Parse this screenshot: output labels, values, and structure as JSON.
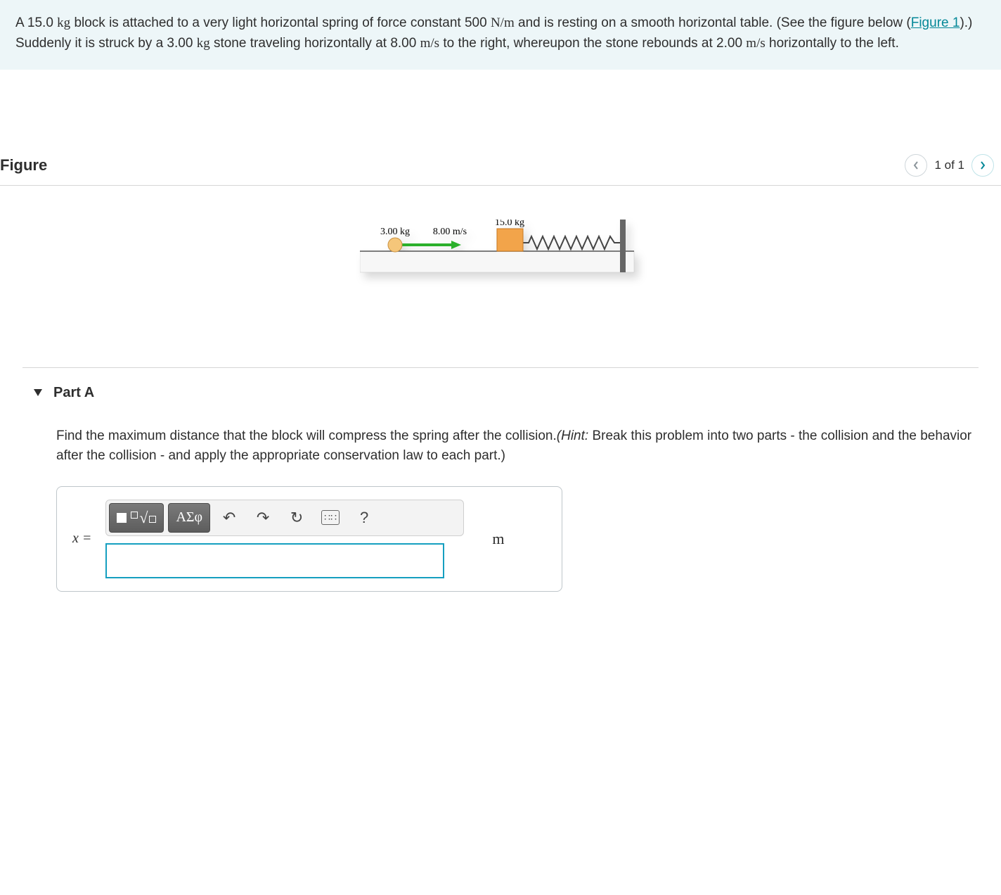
{
  "problem": {
    "text_parts": {
      "p1a": "A 15.0 ",
      "p1b": "kg",
      "p1c": " block is attached to a very light horizontal spring of force constant 500 ",
      "p1d": "N/m",
      "p1e": " and is resting on a smooth horizontal table. (See the figure below (",
      "fig_link": "Figure 1",
      "p1f": ").) Suddenly it is struck by a 3.00 ",
      "p1g": "kg",
      "p1h": " stone traveling horizontally at 8.00 ",
      "p1i": "m/s",
      "p1j": " to the right, whereupon the stone rebounds at 2.00 ",
      "p1k": "m/s",
      "p1l": " horizontally to the left."
    }
  },
  "figure": {
    "title": "Figure",
    "nav_label": "1 of 1",
    "labels": {
      "stone_mass": "3.00 kg",
      "stone_vel": "8.00 m/s",
      "block_mass": "15.0 kg"
    }
  },
  "part": {
    "header": "Part A",
    "question_parts": {
      "q1": "Find the maximum distance that the block will compress the spring after the collision.",
      "hint_label": "(Hint:",
      "q2": " Break this problem into two parts - the collision and the behavior after the collision - and apply the appropriate conservation law to each part.)"
    },
    "answer": {
      "var_label": "x =",
      "unit": "m",
      "value": "",
      "placeholder": ""
    },
    "toolbar": {
      "templates": "■",
      "formula": "√□",
      "greek": "ΑΣφ",
      "undo": "↶",
      "redo": "↷",
      "reset": "↻",
      "keyboard": "⌨",
      "help": "?"
    }
  }
}
